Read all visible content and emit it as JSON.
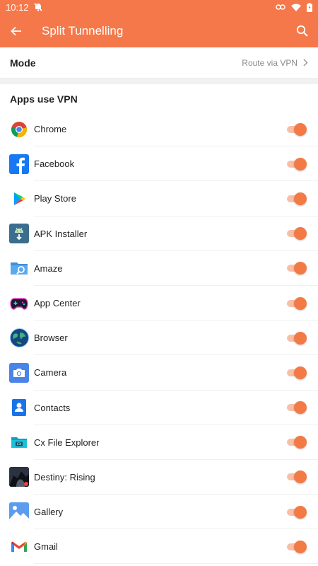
{
  "status_bar": {
    "time": "10:12"
  },
  "app_bar": {
    "title": "Split Tunnelling"
  },
  "mode": {
    "label": "Mode",
    "value": "Route via VPN"
  },
  "section": {
    "title": "Apps use VPN"
  },
  "colors": {
    "accent": "#f5784a",
    "toggle_thumb": "#f47a45",
    "toggle_track": "#f7bfa8"
  },
  "apps": [
    {
      "label": "Chrome",
      "icon": "chrome-icon",
      "enabled": true
    },
    {
      "label": "Facebook",
      "icon": "facebook-icon",
      "enabled": true
    },
    {
      "label": "Play Store",
      "icon": "play-store-icon",
      "enabled": true
    },
    {
      "label": "APK Installer",
      "icon": "apk-installer-icon",
      "enabled": true
    },
    {
      "label": "Amaze",
      "icon": "amaze-icon",
      "enabled": true
    },
    {
      "label": "App Center",
      "icon": "app-center-icon",
      "enabled": true
    },
    {
      "label": "Browser",
      "icon": "browser-icon",
      "enabled": true
    },
    {
      "label": "Camera",
      "icon": "camera-icon",
      "enabled": true
    },
    {
      "label": "Contacts",
      "icon": "contacts-icon",
      "enabled": true
    },
    {
      "label": "Cx File Explorer",
      "icon": "cx-file-explorer-icon",
      "enabled": true
    },
    {
      "label": "Destiny: Rising",
      "icon": "destiny-rising-icon",
      "enabled": true
    },
    {
      "label": "Gallery",
      "icon": "gallery-icon",
      "enabled": true
    },
    {
      "label": "Gmail",
      "icon": "gmail-icon",
      "enabled": true
    }
  ]
}
